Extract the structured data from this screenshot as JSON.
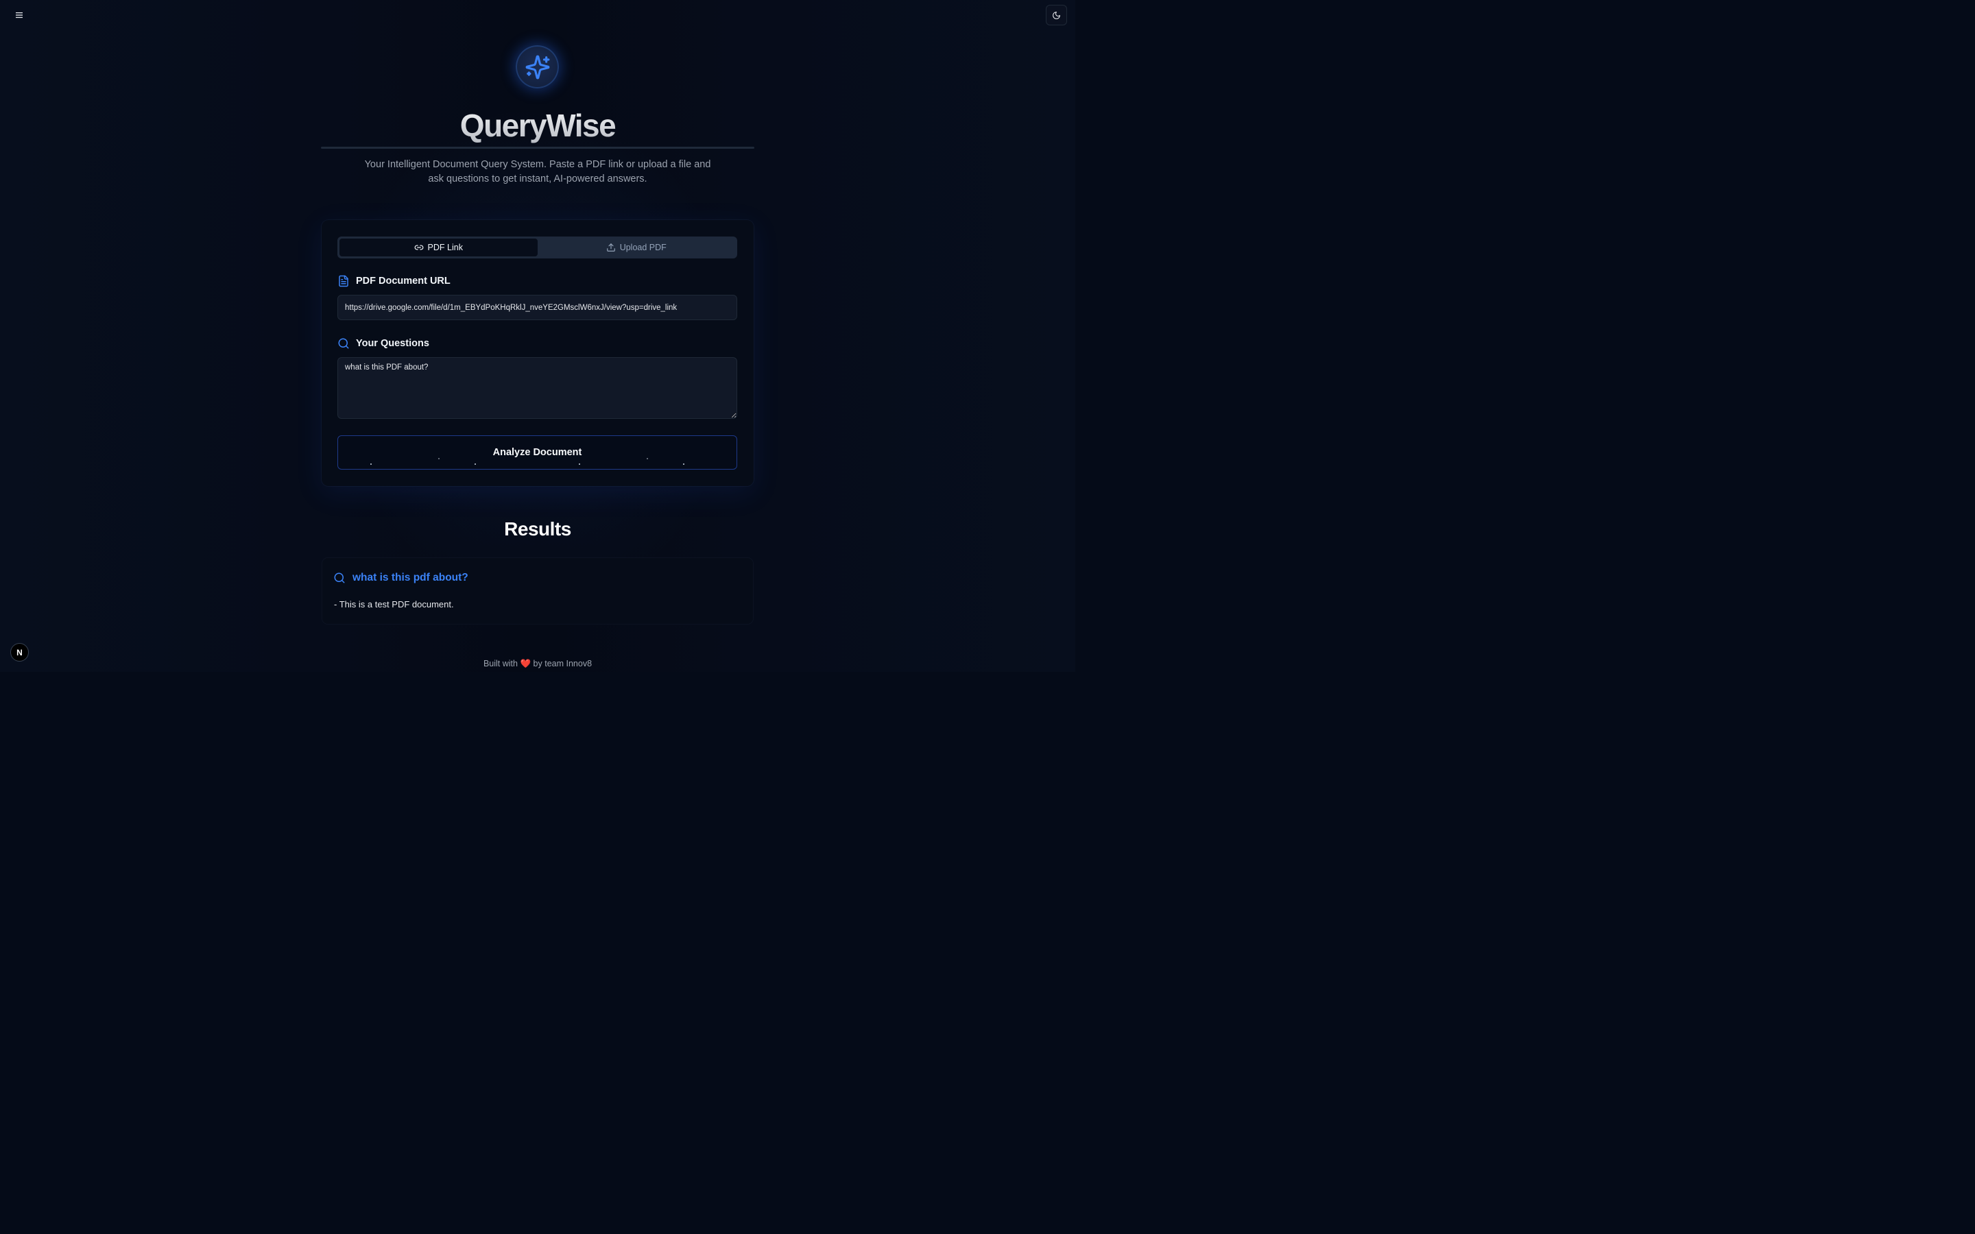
{
  "app": {
    "title": "QueryWise",
    "subtitle": "Your Intelligent Document Query System. Paste a PDF link or upload a file and ask questions to get instant, AI-powered answers."
  },
  "header": {
    "menu_icon": "hamburger-menu-icon",
    "theme_icon": "moon-icon"
  },
  "colors": {
    "accent": "#3b82f6",
    "background": "#050b18",
    "card": "#060c18"
  },
  "tabs": [
    {
      "label": "PDF Link",
      "icon": "link-icon",
      "active": true
    },
    {
      "label": "Upload PDF",
      "icon": "upload-icon",
      "active": false
    }
  ],
  "form": {
    "url_label": "PDF Document URL",
    "url_value": "https://drive.google.com/file/d/1m_EBYdPoKHqRklJ_nveYE2GMsclW6nxJ/view?usp=drive_link",
    "questions_label": "Your Questions",
    "questions_value": "what is this PDF about?",
    "submit_label": "Analyze Document"
  },
  "results": {
    "title": "Results",
    "items": [
      {
        "question": "what is this pdf about?",
        "answer": "- This is a test PDF document."
      }
    ]
  },
  "footer": {
    "prefix": "Built with",
    "heart": "❤️",
    "suffix": "by team Innov8"
  },
  "dev_badge": {
    "label": "N"
  }
}
